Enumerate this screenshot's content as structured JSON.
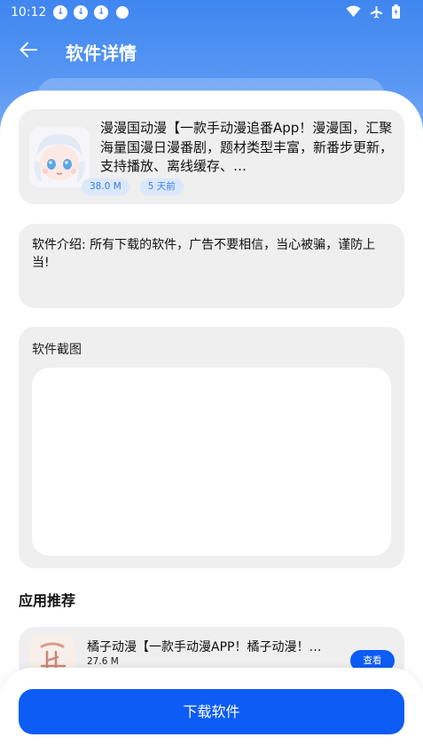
{
  "status_bar": {
    "time": "10:12",
    "icons": [
      "download-icon",
      "download-icon",
      "download-icon",
      "dot-icon",
      "wifi-icon",
      "airplane-icon",
      "battery-icon"
    ]
  },
  "header": {
    "title": "软件详情",
    "back_icon": "arrow-left-icon"
  },
  "app": {
    "description": "漫漫国动漫【一款手动漫追番App！漫漫国，汇聚海量国漫日漫番剧，题材类型丰富，新番步更新，支持播放、离线缓存、…",
    "size": "38.0 M",
    "updated": "5 天前"
  },
  "intro": {
    "text": "软件介绍: 所有下载的软件，广告不要相信，当心被骗，谨防上当!"
  },
  "screenshots": {
    "label": "软件截图"
  },
  "recommend": {
    "title": "应用推荐",
    "items": [
      {
        "name": "橘子动漫【一款手动漫APP！橘子动漫！…",
        "size": "27.6 M",
        "action": "查看"
      }
    ]
  },
  "download": {
    "label": "下载软件"
  },
  "colors": {
    "header_blue": "#4a8df2",
    "primary_button": "#0c5cf5",
    "card_bg": "#efefef",
    "tag_bg": "#dae8fb",
    "tag_text": "#3f7be0"
  }
}
